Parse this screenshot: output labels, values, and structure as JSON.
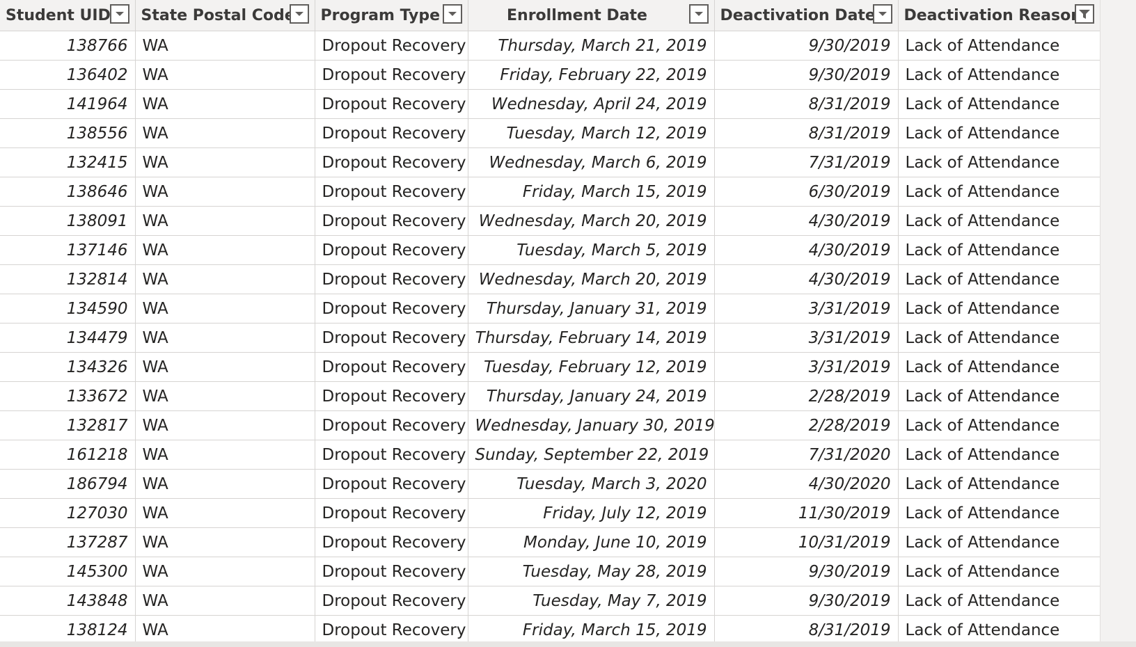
{
  "columns": [
    {
      "label": "Student UID",
      "align": "left",
      "filter_icon": "chevron-down-icon"
    },
    {
      "label": "State Postal Code",
      "align": "left",
      "filter_icon": "chevron-down-icon"
    },
    {
      "label": "Program Type",
      "align": "left",
      "filter_icon": "chevron-down-icon"
    },
    {
      "label": "Enrollment Date",
      "align": "center",
      "filter_icon": "chevron-down-icon"
    },
    {
      "label": "Deactivation Date",
      "align": "left",
      "filter_icon": "chevron-down-icon"
    },
    {
      "label": "Deactivation Reason",
      "align": "left",
      "filter_icon": "filter-applied-icon"
    }
  ],
  "rows": [
    [
      "138766",
      "WA",
      "Dropout Recovery",
      "Thursday, March 21, 2019",
      "9/30/2019",
      "Lack of Attendance"
    ],
    [
      "136402",
      "WA",
      "Dropout Recovery",
      "Friday, February 22, 2019",
      "9/30/2019",
      "Lack of Attendance"
    ],
    [
      "141964",
      "WA",
      "Dropout Recovery",
      "Wednesday, April 24, 2019",
      "8/31/2019",
      "Lack of Attendance"
    ],
    [
      "138556",
      "WA",
      "Dropout Recovery",
      "Tuesday, March 12, 2019",
      "8/31/2019",
      "Lack of Attendance"
    ],
    [
      "132415",
      "WA",
      "Dropout Recovery",
      "Wednesday, March 6, 2019",
      "7/31/2019",
      "Lack of Attendance"
    ],
    [
      "138646",
      "WA",
      "Dropout Recovery",
      "Friday, March 15, 2019",
      "6/30/2019",
      "Lack of Attendance"
    ],
    [
      "138091",
      "WA",
      "Dropout Recovery",
      "Wednesday, March 20, 2019",
      "4/30/2019",
      "Lack of Attendance"
    ],
    [
      "137146",
      "WA",
      "Dropout Recovery",
      "Tuesday, March 5, 2019",
      "4/30/2019",
      "Lack of Attendance"
    ],
    [
      "132814",
      "WA",
      "Dropout Recovery",
      "Wednesday, March 20, 2019",
      "4/30/2019",
      "Lack of Attendance"
    ],
    [
      "134590",
      "WA",
      "Dropout Recovery",
      "Thursday, January 31, 2019",
      "3/31/2019",
      "Lack of Attendance"
    ],
    [
      "134479",
      "WA",
      "Dropout Recovery",
      "Thursday, February 14, 2019",
      "3/31/2019",
      "Lack of Attendance"
    ],
    [
      "134326",
      "WA",
      "Dropout Recovery",
      "Tuesday, February 12, 2019",
      "3/31/2019",
      "Lack of Attendance"
    ],
    [
      "133672",
      "WA",
      "Dropout Recovery",
      "Thursday, January 24, 2019",
      "2/28/2019",
      "Lack of Attendance"
    ],
    [
      "132817",
      "WA",
      "Dropout Recovery",
      "Wednesday, January 30, 2019",
      "2/28/2019",
      "Lack of Attendance"
    ],
    [
      "161218",
      "WA",
      "Dropout Recovery",
      "Sunday, September 22, 2019",
      "7/31/2020",
      "Lack of Attendance"
    ],
    [
      "186794",
      "WA",
      "Dropout Recovery",
      "Tuesday, March 3, 2020",
      "4/30/2020",
      "Lack of Attendance"
    ],
    [
      "127030",
      "WA",
      "Dropout Recovery",
      "Friday, July 12, 2019",
      "11/30/2019",
      "Lack of Attendance"
    ],
    [
      "137287",
      "WA",
      "Dropout Recovery",
      "Monday, June 10, 2019",
      "10/31/2019",
      "Lack of Attendance"
    ],
    [
      "145300",
      "WA",
      "Dropout Recovery",
      "Tuesday, May 28, 2019",
      "9/30/2019",
      "Lack of Attendance"
    ],
    [
      "143848",
      "WA",
      "Dropout Recovery",
      "Tuesday, May 7, 2019",
      "9/30/2019",
      "Lack of Attendance"
    ],
    [
      "138124",
      "WA",
      "Dropout Recovery",
      "Friday, March 15, 2019",
      "8/31/2019",
      "Lack of Attendance"
    ]
  ],
  "cell_styles": [
    "num",
    "txt",
    "txt",
    "num",
    "num",
    "txt"
  ],
  "colors": {
    "header_bg": "#f3f2f1",
    "grid_line": "#d6d4d2",
    "text": "#252423"
  }
}
